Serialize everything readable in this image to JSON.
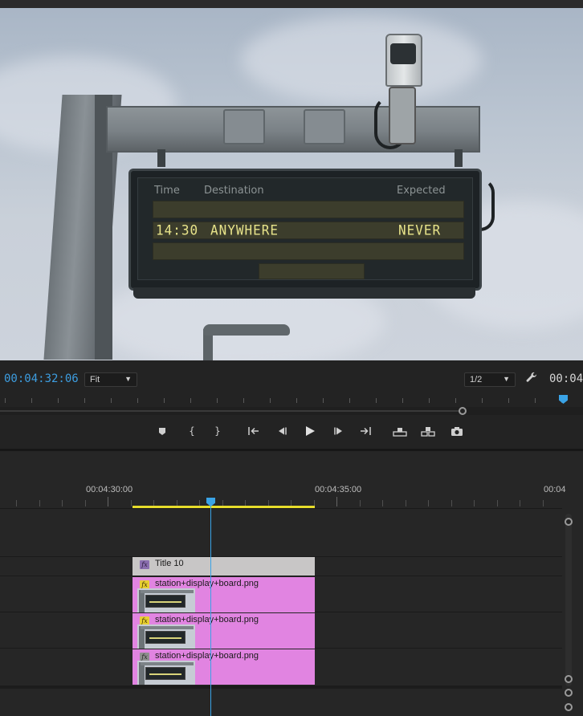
{
  "program_monitor": {
    "board": {
      "header_time": "Time",
      "header_destination": "Destination",
      "header_expected": "Expected",
      "row_time": "14:30",
      "row_destination": "ANYWHERE",
      "row_expected": "NEVER"
    },
    "timecode_current": "00:04:32:06",
    "timecode_duration": "00:04:",
    "zoom_label": "Fit",
    "resolution_label": "1/2"
  },
  "transport": {
    "buttons": [
      "add-marker",
      "mark-in",
      "mark-out",
      "go-to-in",
      "step-back",
      "play",
      "step-forward",
      "go-to-out",
      "lift",
      "extract",
      "export-frame"
    ]
  },
  "timeline": {
    "ruler_labels": [
      "00:04:30:00",
      "00:04:35:00",
      "00:04"
    ],
    "clips": {
      "title": "Title 10",
      "video_1": "station+display+board.png",
      "video_2": "station+display+board.png",
      "video_3": "station+display+board.png"
    }
  },
  "colors": {
    "accent_blue": "#3d9de0",
    "work_area_yellow": "#e6dc2b",
    "clip_pink": "#e184e1",
    "title_clip_gray": "#c8c6c6"
  }
}
